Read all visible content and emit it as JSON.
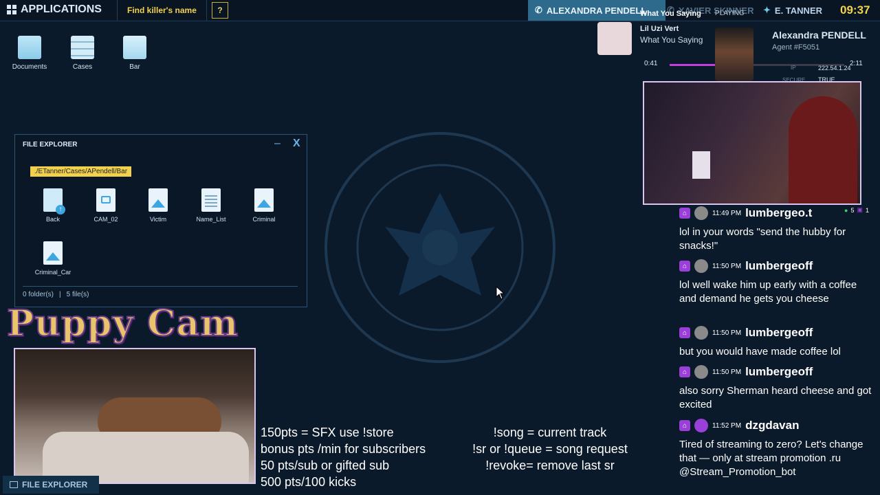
{
  "topbar": {
    "apps_label": "APPLICATIONS",
    "mission": "Find killer's name",
    "help": "?",
    "agents": [
      "ALEXANDRA PENDELL",
      "XAVIER SKINNER",
      "E. TANNER"
    ],
    "clock": "09:37"
  },
  "desktop": {
    "icons": [
      "Documents",
      "Cases",
      "Bar"
    ]
  },
  "file_explorer": {
    "title": "FILE EXPLORER",
    "minimize": "–",
    "close": "X",
    "path": "./ETanner/Cases/APendell/Bar",
    "items": [
      "Back",
      "CAM_02",
      "Victim",
      "Name_List",
      "Criminal",
      "Criminal_Car"
    ],
    "folders": "0 folder(s)",
    "files": "5 file(s)"
  },
  "taskbar": {
    "item": "FILE EXPLORER"
  },
  "overlay": {
    "puppy_cam": "Puppy Cam",
    "commands_left": [
      "150pts = SFX use !store",
      "bonus pts /min for subscribers",
      "50 pts/sub or gifted sub",
      "500 pts/100 kicks"
    ],
    "commands_right": [
      "!song = current track",
      "!sr or !queue = song request",
      "!revoke= remove last sr"
    ]
  },
  "now_playing": {
    "title": "What You Saying",
    "status": "PLAYING",
    "artist": "Lil Uzi Vert",
    "track": "What You Saying",
    "elapsed": "0:41",
    "total": "2:11",
    "progress": 0.31,
    "accent": "#c23ed8"
  },
  "agent": {
    "name": "Alexandra PENDELL",
    "id": "Agent #F5051",
    "ip_label": "IP",
    "ip": "222.54.1.24",
    "secure_label": "SECURE",
    "secure": "TRUE"
  },
  "viewer_stats": {
    "a": "5",
    "b": "1"
  },
  "chat": [
    {
      "time": "11:49 PM",
      "user": "lumbergeo.t",
      "msg": "lol in your words \"send the hubby for snacks!\""
    },
    {
      "time": "11:50 PM",
      "user": "lumbergeoff",
      "msg": "lol well wake him up early with a coffee and demand he gets you cheese"
    },
    {
      "time": "11:50 PM",
      "user": "lumbergeoff",
      "msg": "but you would have made coffee lol"
    },
    {
      "time": "11:50 PM",
      "user": "lumbergeoff",
      "msg": "also sorry Sherman heard cheese and got excited"
    },
    {
      "time": "11:52 PM",
      "user": "dzgdavan",
      "msg": "Tired of streaming to zero? Let's change that — only at stream promotion .ru @Stream_Promotion_bot"
    }
  ]
}
